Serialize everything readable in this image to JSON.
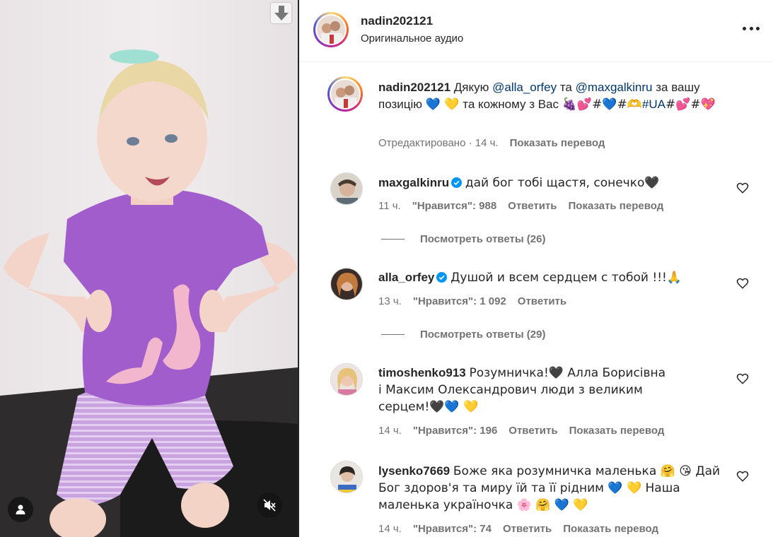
{
  "post": {
    "username": "nadin202121",
    "audio": "Оригинальное аудио"
  },
  "caption": {
    "username": "nadin202121",
    "text_1": "Дякую ",
    "mention_1": "@alla_orfey",
    "text_2": " та ",
    "mention_2": "@maxgalkinru",
    "text_3": " за вашу позицію ",
    "emojis_1": "💙 💛",
    "text_4": " та кожному з Вас ",
    "emojis_2": "🍇💕#💙#🫶",
    "tag_ua": "#UA",
    "emojis_3": "#💕#💖",
    "edited": "Отредактировано",
    "time": "14 ч.",
    "translate": "Показать перевод"
  },
  "comments": [
    {
      "username": "maxgalkinru",
      "verified": true,
      "text": "дай бог тобі щастя, сонечко🖤",
      "time": "11 ч.",
      "likes": "\"Нравится\": 988",
      "reply": "Ответить",
      "translate": "Показать перевод",
      "view_replies": "Посмотреть ответы (26)"
    },
    {
      "username": "alla_orfey",
      "verified": true,
      "text": "Душой и всем сердцем с тобой !!!🙏",
      "time": "13 ч.",
      "likes": "\"Нравится\": 1 092",
      "reply": "Ответить",
      "view_replies": "Посмотреть ответы (29)"
    },
    {
      "username": "timoshenko913",
      "verified": false,
      "text": "Розумничка!🖤 Алла Борисівна і Максим Олександрович люди з великим серцем!🖤💙 💛",
      "time": "14 ч.",
      "likes": "\"Нравится\": 196",
      "reply": "Ответить",
      "translate": "Показать перевод"
    },
    {
      "username": "lysenko7669",
      "verified": false,
      "text": "Боже яка розумничка маленька 🤗 😘 Дай Бог здоров'я та миру їй та її рідним 💙 💛 Наша маленька україночка 🌸 🤗 💙 💛",
      "time": "14 ч.",
      "likes": "\"Нравится\": 74",
      "reply": "Ответить",
      "translate": "Показать перевод"
    }
  ],
  "icons": {
    "download": "download-arrow-icon",
    "user": "user-icon",
    "mute": "speaker-muted-icon",
    "more": "more-options-icon",
    "heart": "heart-outline-icon",
    "verified": "verified-badge-icon"
  },
  "colors": {
    "mention": "#00376b",
    "verified": "#0095f6",
    "meta": "#737373",
    "text": "#262626"
  }
}
